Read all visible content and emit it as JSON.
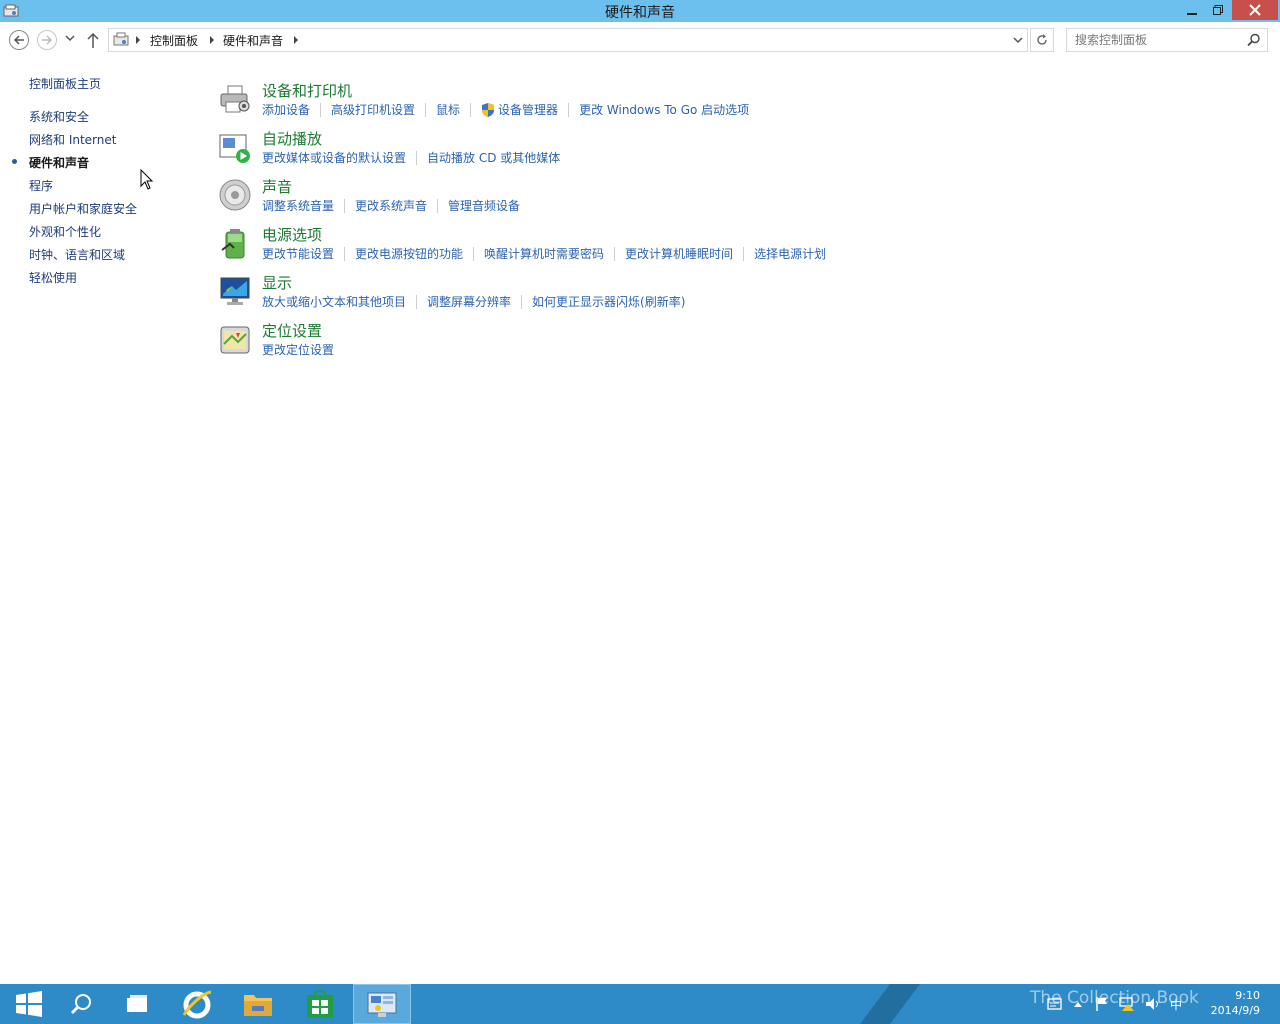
{
  "window": {
    "title": "硬件和声音"
  },
  "nav": {
    "breadcrumbs": [
      "控制面板",
      "硬件和声音"
    ],
    "search_placeholder": "搜索控制面板"
  },
  "sidebar": {
    "home": "控制面板主页",
    "items": [
      {
        "label": "系统和安全"
      },
      {
        "label": "网络和 Internet"
      },
      {
        "label": "硬件和声音"
      },
      {
        "label": "程序"
      },
      {
        "label": "用户帐户和家庭安全"
      },
      {
        "label": "外观和个性化"
      },
      {
        "label": "时钟、语言和区域"
      },
      {
        "label": "轻松使用"
      }
    ]
  },
  "categories": [
    {
      "title": "设备和打印机",
      "icon": "printer-icon",
      "links": [
        "添加设备",
        "高级打印机设置",
        "鼠标",
        "设备管理器",
        "更改 Windows To Go 启动选项"
      ]
    },
    {
      "title": "自动播放",
      "icon": "autoplay-icon",
      "links": [
        "更改媒体或设备的默认设置",
        "自动播放 CD 或其他媒体"
      ]
    },
    {
      "title": "声音",
      "icon": "speaker-icon",
      "links": [
        "调整系统音量",
        "更改系统声音",
        "管理音频设备"
      ]
    },
    {
      "title": "电源选项",
      "icon": "battery-icon",
      "links": [
        "更改节能设置",
        "更改电源按钮的功能",
        "唤醒计算机时需要密码",
        "更改计算机睡眠时间",
        "选择电源计划"
      ]
    },
    {
      "title": "显示",
      "icon": "monitor-icon",
      "links": [
        "放大或缩小文本和其他项目",
        "调整屏幕分辨率",
        "如何更正显示器闪烁(刷新率)"
      ]
    },
    {
      "title": "定位设置",
      "icon": "location-icon",
      "links": [
        "更改定位设置"
      ]
    }
  ],
  "taskbar": {
    "time": "9:10",
    "date": "2014/9/9",
    "ime": "中",
    "watermark": "The Collection Book"
  },
  "colors": {
    "titlebar": "#6bc0ee",
    "taskbar": "#2f8bc8",
    "category_title": "#1e7a33",
    "link": "#2c63b0",
    "close_button": "#c7504c"
  }
}
